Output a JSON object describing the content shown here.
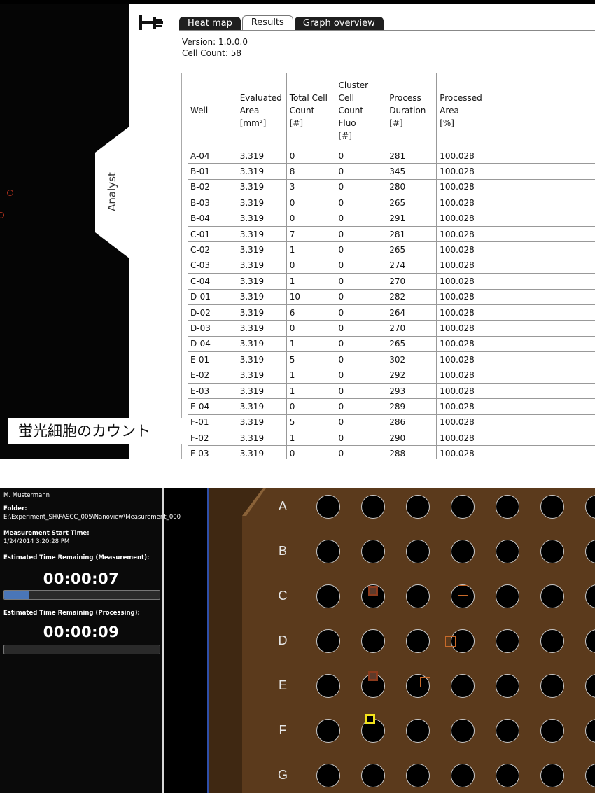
{
  "top": {
    "tabs": [
      {
        "label": "Heat map",
        "active": false
      },
      {
        "label": "Results",
        "active": true
      },
      {
        "label": "Graph overview",
        "active": false
      }
    ],
    "version": "Version: 1.0.0.0",
    "cell_count": "Cell Count: 58",
    "side_tab": "Analyst",
    "caption": "蛍光細胞のカウント",
    "columns": [
      {
        "lines": [
          "Well"
        ]
      },
      {
        "lines": [
          "Evaluated",
          "Area",
          "[mm²]"
        ]
      },
      {
        "lines": [
          "Total Cell",
          "Count",
          "[#]"
        ]
      },
      {
        "lines": [
          "Cluster",
          "Cell",
          "Count",
          "Fluo",
          "[#]"
        ]
      },
      {
        "lines": [
          "Process",
          "Duration",
          "[#]"
        ]
      },
      {
        "lines": [
          "Processed",
          "Area",
          "[%]"
        ]
      }
    ],
    "rows": [
      [
        "A-04",
        "3.319",
        "0",
        "0",
        "281",
        "100.028"
      ],
      [
        "B-01",
        "3.319",
        "8",
        "0",
        "345",
        "100.028"
      ],
      [
        "B-02",
        "3.319",
        "3",
        "0",
        "280",
        "100.028"
      ],
      [
        "B-03",
        "3.319",
        "0",
        "0",
        "265",
        "100.028"
      ],
      [
        "B-04",
        "3.319",
        "0",
        "0",
        "291",
        "100.028"
      ],
      [
        "C-01",
        "3.319",
        "7",
        "0",
        "281",
        "100.028"
      ],
      [
        "C-02",
        "3.319",
        "1",
        "0",
        "265",
        "100.028"
      ],
      [
        "C-03",
        "3.319",
        "0",
        "0",
        "274",
        "100.028"
      ],
      [
        "C-04",
        "3.319",
        "1",
        "0",
        "270",
        "100.028"
      ],
      [
        "D-01",
        "3.319",
        "10",
        "0",
        "282",
        "100.028"
      ],
      [
        "D-02",
        "3.319",
        "6",
        "0",
        "264",
        "100.028"
      ],
      [
        "D-03",
        "3.319",
        "0",
        "0",
        "270",
        "100.028"
      ],
      [
        "D-04",
        "3.319",
        "1",
        "0",
        "265",
        "100.028"
      ],
      [
        "E-01",
        "3.319",
        "5",
        "0",
        "302",
        "100.028"
      ],
      [
        "E-02",
        "3.319",
        "1",
        "0",
        "292",
        "100.028"
      ],
      [
        "E-03",
        "3.319",
        "1",
        "0",
        "293",
        "100.028"
      ],
      [
        "E-04",
        "3.319",
        "0",
        "0",
        "289",
        "100.028"
      ],
      [
        "F-01",
        "3.319",
        "5",
        "0",
        "286",
        "100.028"
      ],
      [
        "F-02",
        "3.319",
        "1",
        "0",
        "290",
        "100.028"
      ],
      [
        "F-03",
        "3.319",
        "0",
        "0",
        "288",
        "100.028"
      ]
    ]
  },
  "bottom": {
    "user": "M. Mustermann",
    "folder_label": "Folder:",
    "folder_path": "E:\\Experiment_SH\\FASCC_005\\Nanoview\\Measurement_000",
    "start_label": "Measurement Start Time:",
    "start_value": "1/24/2014 3:20:28 PM",
    "remaining_measurement_label": "Estimated Time Remaining (Measurement):",
    "remaining_measurement_value": "00:00:07",
    "measurement_progress": 0.16,
    "remaining_processing_label": "Estimated Time Remaining (Processing):",
    "remaining_processing_value": "00:00:09",
    "processing_progress": 0.0,
    "plate_rows": [
      "A",
      "B",
      "C",
      "D",
      "E",
      "F",
      "G"
    ],
    "progress_color": "#4a76b8",
    "highlight_color": "#f3e21c"
  }
}
